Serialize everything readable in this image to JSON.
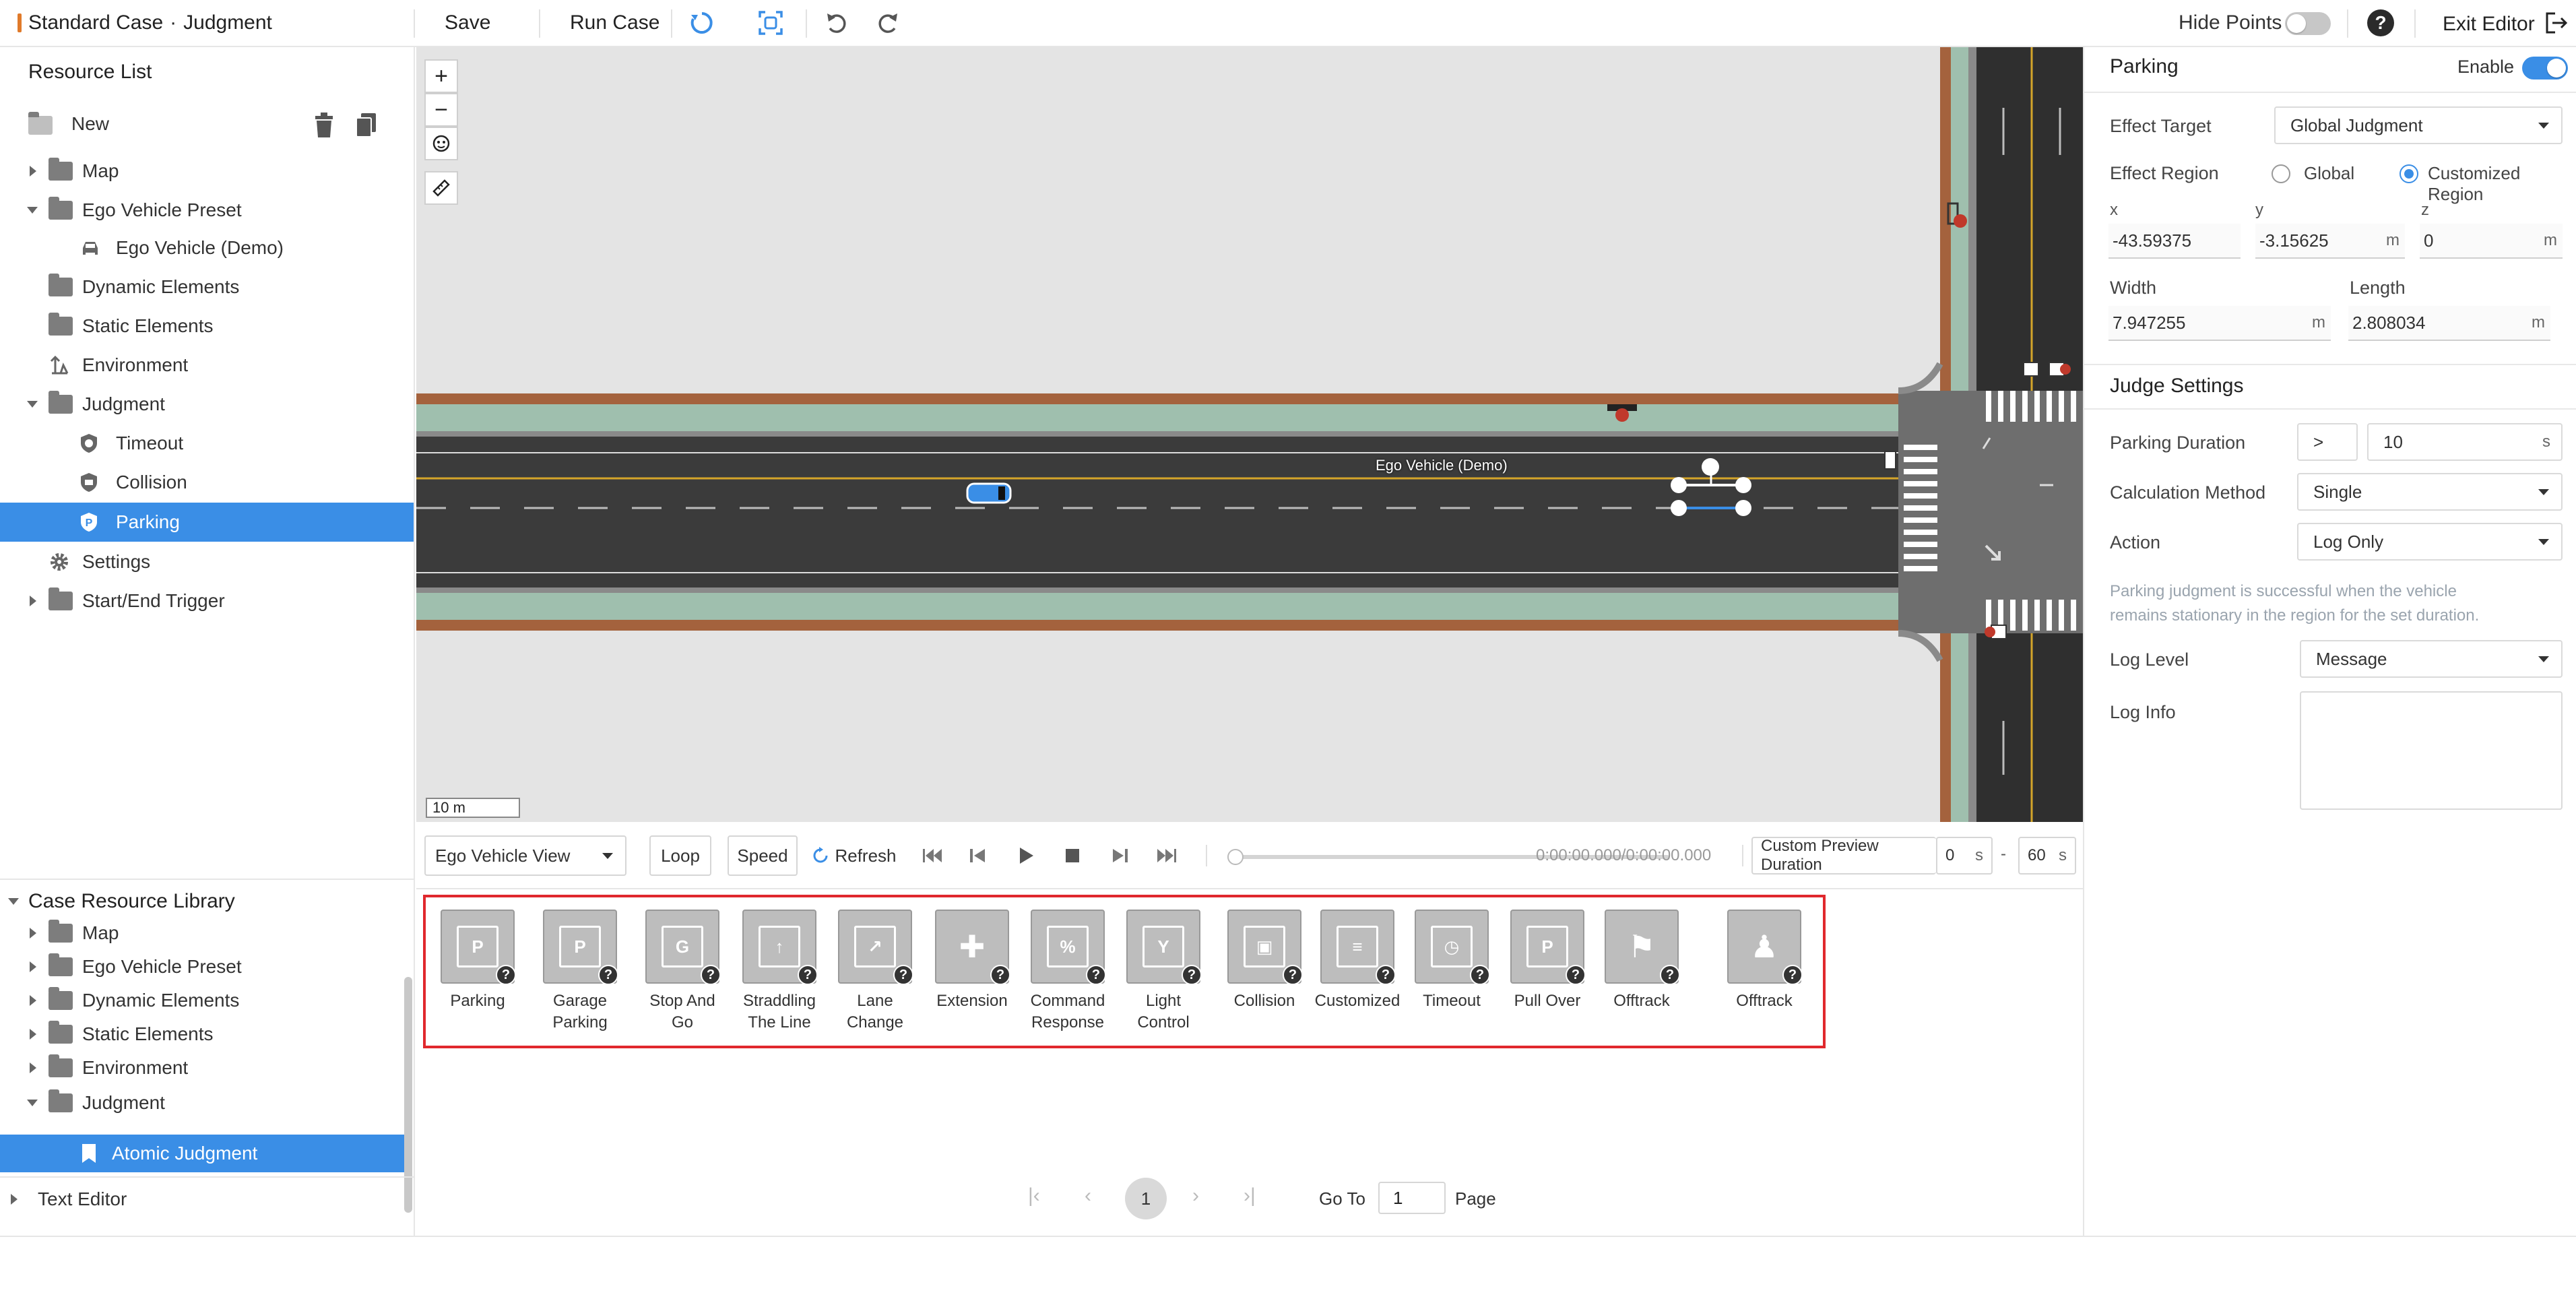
{
  "header": {
    "title": "Standard Case",
    "separator": "·",
    "subtitle": "Judgment",
    "save_label": "Save",
    "run_case_label": "Run Case",
    "hide_points_label": "Hide Points",
    "help_label": "?",
    "exit_editor_label": "Exit Editor"
  },
  "resource_list": {
    "title": "Resource List",
    "new_label": "New",
    "items": [
      {
        "label": "Map"
      },
      {
        "label": "Ego Vehicle Preset"
      },
      {
        "label": "Ego Vehicle (Demo)"
      },
      {
        "label": "Dynamic Elements"
      },
      {
        "label": "Static Elements"
      },
      {
        "label": "Environment"
      },
      {
        "label": "Judgment"
      },
      {
        "label": "Timeout"
      },
      {
        "label": "Collision"
      },
      {
        "label": "Parking"
      },
      {
        "label": "Settings"
      },
      {
        "label": "Start/End Trigger"
      }
    ]
  },
  "case_library": {
    "title": "Case Resource Library",
    "items": [
      {
        "label": "Map"
      },
      {
        "label": "Ego Vehicle Preset"
      },
      {
        "label": "Dynamic Elements"
      },
      {
        "label": "Static Elements"
      },
      {
        "label": "Environment"
      },
      {
        "label": "Judgment"
      },
      {
        "label": "Atomic Judgment"
      }
    ],
    "text_editor_label": "Text Editor"
  },
  "map": {
    "zoom_in": "+",
    "zoom_out": "−",
    "scale_label": "10 m",
    "ego_label": "Ego Vehicle (Demo)"
  },
  "playback": {
    "view_select": "Ego Vehicle View",
    "loop_label": "Loop",
    "speed_label": "Speed",
    "refresh_label": "Refresh",
    "time_display": "0:00:00.000/0:00:00.000",
    "preview_duration_label": "Custom Preview Duration",
    "start_value": "0",
    "end_value": "60",
    "unit": "s",
    "dash": "-"
  },
  "palette": {
    "help_mark": "?",
    "items": [
      {
        "label": "Parking",
        "glyph": "P"
      },
      {
        "label": "Garage Parking",
        "glyph": "P"
      },
      {
        "label": "Stop And Go",
        "glyph": "G"
      },
      {
        "label": "Straddling\nThe Line",
        "glyph": "↑"
      },
      {
        "label": "Lane Change",
        "glyph": "↗"
      },
      {
        "label": "Extension",
        "glyph": "✚"
      },
      {
        "label": "Command\nResponse",
        "glyph": "%"
      },
      {
        "label": "Light Control",
        "glyph": "Y"
      },
      {
        "label": "Collision",
        "glyph": "▣"
      },
      {
        "label": "Customized",
        "glyph": "≡"
      },
      {
        "label": "Timeout",
        "glyph": "◷"
      },
      {
        "label": "Pull Over",
        "glyph": "P"
      },
      {
        "label": "Offtrack",
        "glyph": "⚑"
      },
      {
        "label": "Offtrack",
        "glyph": "♟"
      }
    ]
  },
  "pagination": {
    "first": "|‹",
    "prev": "‹",
    "current": "1",
    "next": "›",
    "last": "›|",
    "goto_label": "Go To",
    "goto_value": "1",
    "page_label": "Page"
  },
  "parking_panel": {
    "title": "Parking",
    "enable_label": "Enable",
    "effect_target_label": "Effect Target",
    "effect_target_value": "Global Judgment",
    "effect_region_label": "Effect Region",
    "region_global": "Global",
    "region_custom": "Customized Region",
    "x_label": "x",
    "x_value": "-43.59375",
    "y_label": "y",
    "y_value": "-3.15625",
    "z_label": "z",
    "z_value": "0",
    "width_label": "Width",
    "width_value": "7.947255",
    "length_label": "Length",
    "length_value": "2.808034",
    "unit_m": "m"
  },
  "judge_settings": {
    "title": "Judge Settings",
    "parking_duration_label": "Parking Duration",
    "operator": ">",
    "duration_value": "10",
    "duration_unit": "s",
    "calc_method_label": "Calculation Method",
    "calc_method_value": "Single",
    "action_label": "Action",
    "action_value": "Log Only",
    "note_line1": "Parking judgment is successful when the vehicle",
    "note_line2": "remains stationary in the region for the set duration.",
    "log_level_label": "Log Level",
    "log_level_value": "Message",
    "log_info_label": "Log Info"
  },
  "colors": {
    "accent": "#3a8ee6",
    "palette_border": "#e0282d",
    "road": "#3b3b3b",
    "sidewalk": "#9fbfae",
    "curb": "#a4623d"
  }
}
